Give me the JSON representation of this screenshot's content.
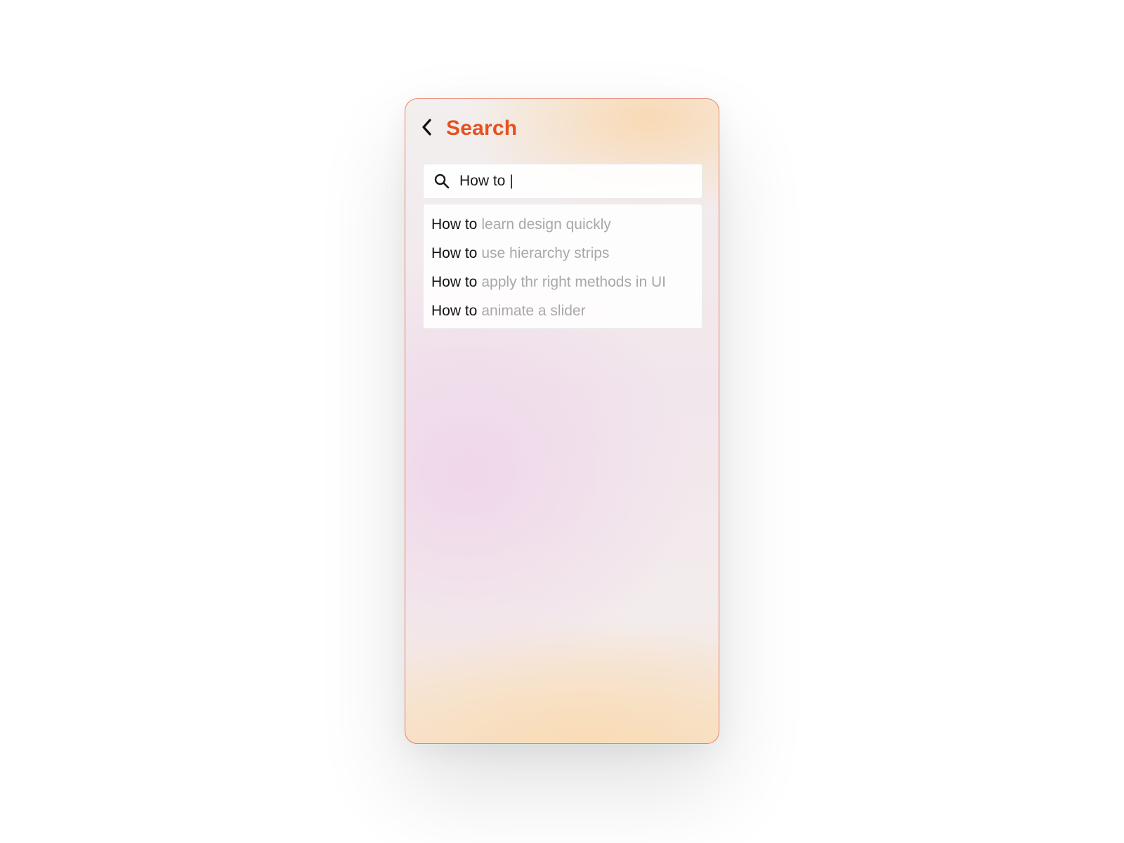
{
  "colors": {
    "accent": "#e2531f",
    "border": "#e9826a",
    "suggestion_completion": "#a8a8a8"
  },
  "header": {
    "back_icon": "chevron-left-icon",
    "title": "Search"
  },
  "search": {
    "icon": "search-icon",
    "value": "How to |"
  },
  "suggestions": [
    {
      "prefix": "How to",
      "completion": "learn design quickly"
    },
    {
      "prefix": "How to",
      "completion": "use hierarchy strips"
    },
    {
      "prefix": "How to",
      "completion": "apply thr right methods in UI"
    },
    {
      "prefix": "How to",
      "completion": "animate a slider"
    }
  ]
}
